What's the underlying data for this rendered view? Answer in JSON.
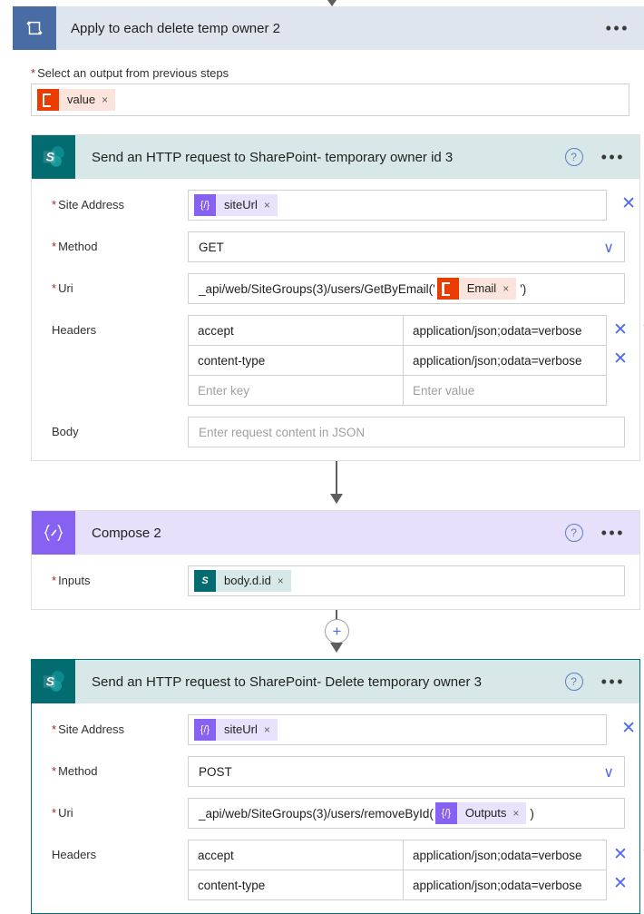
{
  "scope": {
    "title": "Apply to each delete temp owner 2",
    "icon": "loop-icon",
    "ellipsis": "•••",
    "select_output_label": "Select an output from previous steps",
    "required_mark": "*",
    "selected_token": {
      "text": "value",
      "icon": "office365-outlook-icon",
      "remove": "×"
    }
  },
  "actions": [
    {
      "id": "http-temp-owner-id-3",
      "title": "Send an HTTP request to SharePoint- temporary owner id 3",
      "icon": "sharepoint-icon",
      "help": "?",
      "ellipsis": "•••",
      "selected": false,
      "site_address": {
        "label": "Site Address",
        "required": "*",
        "token": {
          "text": "siteUrl",
          "icon": "expression-icon",
          "remove": "×"
        },
        "clear": "✕"
      },
      "method": {
        "label": "Method",
        "required": "*",
        "value": "GET",
        "chevron": "∨"
      },
      "uri": {
        "label": "Uri",
        "required": "*",
        "prefix": "_api/web/SiteGroups(3)/users/GetByEmail('",
        "token": {
          "text": "Email",
          "icon": "office365-outlook-icon",
          "remove": "×"
        },
        "suffix": "')"
      },
      "headers": {
        "label": "Headers",
        "rows": [
          {
            "key": "accept",
            "value": "application/json;odata=verbose",
            "remove": "✕",
            "delete_icon": "delete-table-icon"
          },
          {
            "key": "content-type",
            "value": "application/json;odata=verbose",
            "remove": "✕",
            "delete_icon": ""
          },
          {
            "key": "Enter key",
            "value": "Enter value",
            "placeholder": true,
            "remove": "",
            "delete_icon": ""
          }
        ]
      },
      "body": {
        "label": "Body",
        "placeholder": "Enter request content in JSON"
      }
    },
    {
      "id": "compose-2",
      "title": "Compose 2",
      "icon": "compose-expression-icon",
      "help": "?",
      "ellipsis": "•••",
      "inputs": {
        "label": "Inputs",
        "required": "*",
        "token": {
          "text": "body.d.id",
          "icon": "sharepoint-icon",
          "remove": "×"
        }
      }
    },
    {
      "id": "http-delete-temp-owner-3",
      "title": "Send an HTTP request to SharePoint- Delete temporary owner 3",
      "icon": "sharepoint-icon",
      "help": "?",
      "ellipsis": "•••",
      "selected": true,
      "site_address": {
        "label": "Site Address",
        "required": "*",
        "token": {
          "text": "siteUrl",
          "icon": "expression-icon",
          "remove": "×"
        },
        "clear": "✕"
      },
      "method": {
        "label": "Method",
        "required": "*",
        "value": "POST",
        "chevron": "∨"
      },
      "uri": {
        "label": "Uri",
        "required": "*",
        "prefix": "_api/web/SiteGroups(3)/users/removeById(",
        "token": {
          "text": "Outputs",
          "icon": "expression-icon",
          "remove": "×"
        },
        "suffix": ")"
      },
      "headers": {
        "label": "Headers",
        "rows": [
          {
            "key": "accept",
            "value": "application/json;odata=verbose",
            "remove": "✕",
            "delete_icon": "delete-table-icon"
          },
          {
            "key": "content-type",
            "value": "application/json;odata=verbose",
            "remove": "✕",
            "delete_icon": ""
          }
        ]
      }
    }
  ],
  "connectors": {
    "plus": "+"
  },
  "colors": {
    "scope_header_bg": "#dfe5ee",
    "scope_icon_bg": "#486ca3",
    "sharepoint_teal": "#036c70",
    "sharepoint_header_bg": "#d8e8e8",
    "compose_purple": "#8661f2",
    "compose_header_bg": "#e7e0fb",
    "office_orange": "#eb3c00",
    "required_red": "#a4262c",
    "action_blue": "#4f6bed"
  }
}
